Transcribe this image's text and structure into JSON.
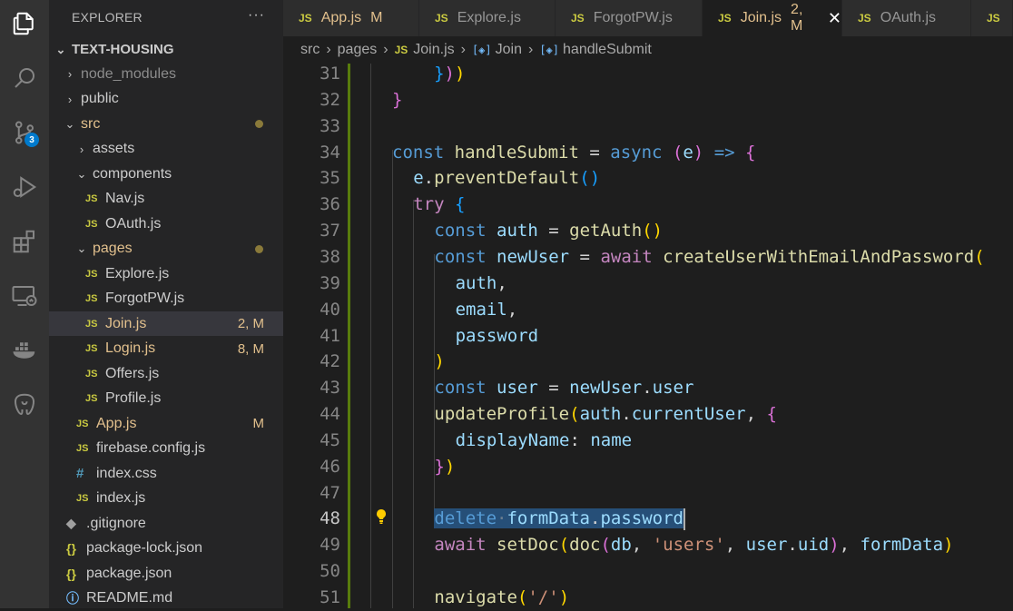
{
  "activity_bar": {
    "items": [
      {
        "name": "explorer",
        "icon": "files-icon"
      },
      {
        "name": "search",
        "icon": "search-icon"
      },
      {
        "name": "source-control",
        "icon": "source-control-icon",
        "badge": "3"
      },
      {
        "name": "run-debug",
        "icon": "run-debug-icon"
      },
      {
        "name": "extensions",
        "icon": "extensions-icon"
      },
      {
        "name": "remote-explorer",
        "icon": "remote-explorer-icon"
      },
      {
        "name": "docker",
        "icon": "docker-icon"
      },
      {
        "name": "postgres",
        "icon": "postgres-icon"
      }
    ]
  },
  "explorer": {
    "title": "EXPLORER",
    "more": "···",
    "root": "TEXT-HOUSING",
    "tree": [
      {
        "label": "node_modules",
        "type": "folder",
        "open": false,
        "depth": 1,
        "muted": true
      },
      {
        "label": "public",
        "type": "folder",
        "open": false,
        "depth": 1
      },
      {
        "label": "src",
        "type": "folder",
        "open": true,
        "depth": 1,
        "modified": true,
        "dot": true
      },
      {
        "label": "assets",
        "type": "folder",
        "open": false,
        "depth": 2
      },
      {
        "label": "components",
        "type": "folder",
        "open": true,
        "depth": 2
      },
      {
        "label": "Nav.js",
        "type": "js",
        "depth": 3
      },
      {
        "label": "OAuth.js",
        "type": "js",
        "depth": 3
      },
      {
        "label": "pages",
        "type": "folder",
        "open": true,
        "depth": 2,
        "modified": true,
        "dot": true
      },
      {
        "label": "Explore.js",
        "type": "js",
        "depth": 3
      },
      {
        "label": "ForgotPW.js",
        "type": "js",
        "depth": 3
      },
      {
        "label": "Join.js",
        "type": "js",
        "depth": 3,
        "modified": true,
        "status": "2, M",
        "selected": true
      },
      {
        "label": "Login.js",
        "type": "js",
        "depth": 3,
        "modified": true,
        "status": "8, M"
      },
      {
        "label": "Offers.js",
        "type": "js",
        "depth": 3
      },
      {
        "label": "Profile.js",
        "type": "js",
        "depth": 3
      },
      {
        "label": "App.js",
        "type": "js",
        "depth": 2,
        "modified": true,
        "status": "M"
      },
      {
        "label": "firebase.config.js",
        "type": "js",
        "depth": 2
      },
      {
        "label": "index.css",
        "type": "css",
        "depth": 2
      },
      {
        "label": "index.js",
        "type": "js",
        "depth": 2
      },
      {
        "label": ".gitignore",
        "type": "git",
        "depth": 1
      },
      {
        "label": "package-lock.json",
        "type": "json",
        "depth": 1
      },
      {
        "label": "package.json",
        "type": "json",
        "depth": 1
      },
      {
        "label": "README.md",
        "type": "info",
        "depth": 1
      }
    ]
  },
  "tabs": [
    {
      "label": "App.js",
      "status": "M",
      "modified": true
    },
    {
      "label": "Explore.js"
    },
    {
      "label": "ForgotPW.js"
    },
    {
      "label": "Join.js",
      "status": "2, M",
      "modified": true,
      "active": true
    },
    {
      "label": "OAuth.js"
    },
    {
      "label": "JS"
    }
  ],
  "breadcrumb": [
    "src",
    "pages",
    "Join.js",
    "Join",
    "handleSubmit"
  ],
  "editor": {
    "current_line": 48,
    "lines": [
      {
        "n": 31,
        "indent": 1,
        "tokens": [
          [
            "  ",
            ""
          ],
          [
            "}",
            "b3"
          ],
          [
            ")",
            "b2"
          ],
          [
            ")",
            "b1"
          ]
        ]
      },
      {
        "n": 32,
        "indent": 0,
        "tokens": [
          [
            "}",
            "b2"
          ]
        ]
      },
      {
        "n": 33,
        "indent": 0,
        "tokens": []
      },
      {
        "n": 34,
        "indent": 0,
        "tokens": [
          [
            "const ",
            "kw"
          ],
          [
            "handleSubmit",
            "fn"
          ],
          [
            " = ",
            ""
          ],
          [
            "async ",
            "kw"
          ],
          [
            "(",
            "b2"
          ],
          [
            "e",
            "var"
          ],
          [
            ")",
            "b2"
          ],
          [
            " => ",
            "kw"
          ],
          [
            "{",
            "b2"
          ]
        ]
      },
      {
        "n": 35,
        "indent": 1,
        "tokens": [
          [
            "e",
            "var"
          ],
          [
            ".",
            ""
          ],
          [
            "preventDefault",
            "fn"
          ],
          [
            "()",
            "b3"
          ]
        ]
      },
      {
        "n": 36,
        "indent": 1,
        "tokens": [
          [
            "try ",
            "ctl"
          ],
          [
            "{",
            "b3"
          ]
        ]
      },
      {
        "n": 37,
        "indent": 2,
        "tokens": [
          [
            "const ",
            "kw"
          ],
          [
            "auth",
            "var"
          ],
          [
            " = ",
            ""
          ],
          [
            "getAuth",
            "fn"
          ],
          [
            "()",
            "b1"
          ]
        ]
      },
      {
        "n": 38,
        "indent": 2,
        "tokens": [
          [
            "const ",
            "kw"
          ],
          [
            "newUser",
            "var"
          ],
          [
            " = ",
            ""
          ],
          [
            "await ",
            "ctl"
          ],
          [
            "createUserWithEmailAndPassword",
            "fn"
          ],
          [
            "(",
            "b1"
          ]
        ]
      },
      {
        "n": 39,
        "indent": 3,
        "tokens": [
          [
            "auth",
            "var"
          ],
          [
            ",",
            ""
          ]
        ]
      },
      {
        "n": 40,
        "indent": 3,
        "tokens": [
          [
            "email",
            "var"
          ],
          [
            ",",
            ""
          ]
        ]
      },
      {
        "n": 41,
        "indent": 3,
        "tokens": [
          [
            "password",
            "var"
          ]
        ]
      },
      {
        "n": 42,
        "indent": 2,
        "tokens": [
          [
            ")",
            "b1"
          ]
        ]
      },
      {
        "n": 43,
        "indent": 2,
        "tokens": [
          [
            "const ",
            "kw"
          ],
          [
            "user",
            "var"
          ],
          [
            " = ",
            ""
          ],
          [
            "newUser",
            "var"
          ],
          [
            ".",
            ""
          ],
          [
            "user",
            "var"
          ]
        ]
      },
      {
        "n": 44,
        "indent": 2,
        "tokens": [
          [
            "updateProfile",
            "fn"
          ],
          [
            "(",
            "b1"
          ],
          [
            "auth",
            "var"
          ],
          [
            ".",
            ""
          ],
          [
            "currentUser",
            "var"
          ],
          [
            ", ",
            ""
          ],
          [
            "{",
            "b2"
          ]
        ]
      },
      {
        "n": 45,
        "indent": 3,
        "tokens": [
          [
            "displayName",
            "var"
          ],
          [
            ": ",
            ""
          ],
          [
            "name",
            "var"
          ]
        ]
      },
      {
        "n": 46,
        "indent": 2,
        "tokens": [
          [
            "}",
            "b2"
          ],
          [
            ")",
            "b1"
          ]
        ]
      },
      {
        "n": 47,
        "indent": 0,
        "tokens": []
      },
      {
        "n": 48,
        "indent": 2,
        "selected": true,
        "tokens": [
          [
            "delete",
            "kw"
          ],
          [
            "·",
            "ws"
          ],
          [
            "formData",
            "var"
          ],
          [
            ".",
            ""
          ],
          [
            "password",
            "var"
          ]
        ]
      },
      {
        "n": 49,
        "indent": 2,
        "tokens": [
          [
            "await ",
            "ctl"
          ],
          [
            "setDoc",
            "fn"
          ],
          [
            "(",
            "b1"
          ],
          [
            "doc",
            "fn"
          ],
          [
            "(",
            "b2"
          ],
          [
            "db",
            "var"
          ],
          [
            ", ",
            ""
          ],
          [
            "'users'",
            "str"
          ],
          [
            ", ",
            ""
          ],
          [
            "user",
            "var"
          ],
          [
            ".",
            ""
          ],
          [
            "uid",
            "var"
          ],
          [
            ")",
            "b2"
          ],
          [
            ", ",
            ""
          ],
          [
            "formData",
            "var"
          ],
          [
            ")",
            "b1"
          ]
        ]
      },
      {
        "n": 50,
        "indent": 0,
        "tokens": []
      },
      {
        "n": 51,
        "indent": 2,
        "tokens": [
          [
            "navigate",
            "fn"
          ],
          [
            "(",
            "b1"
          ],
          [
            "'/'",
            "str"
          ],
          [
            ")",
            "b1"
          ]
        ]
      }
    ]
  }
}
